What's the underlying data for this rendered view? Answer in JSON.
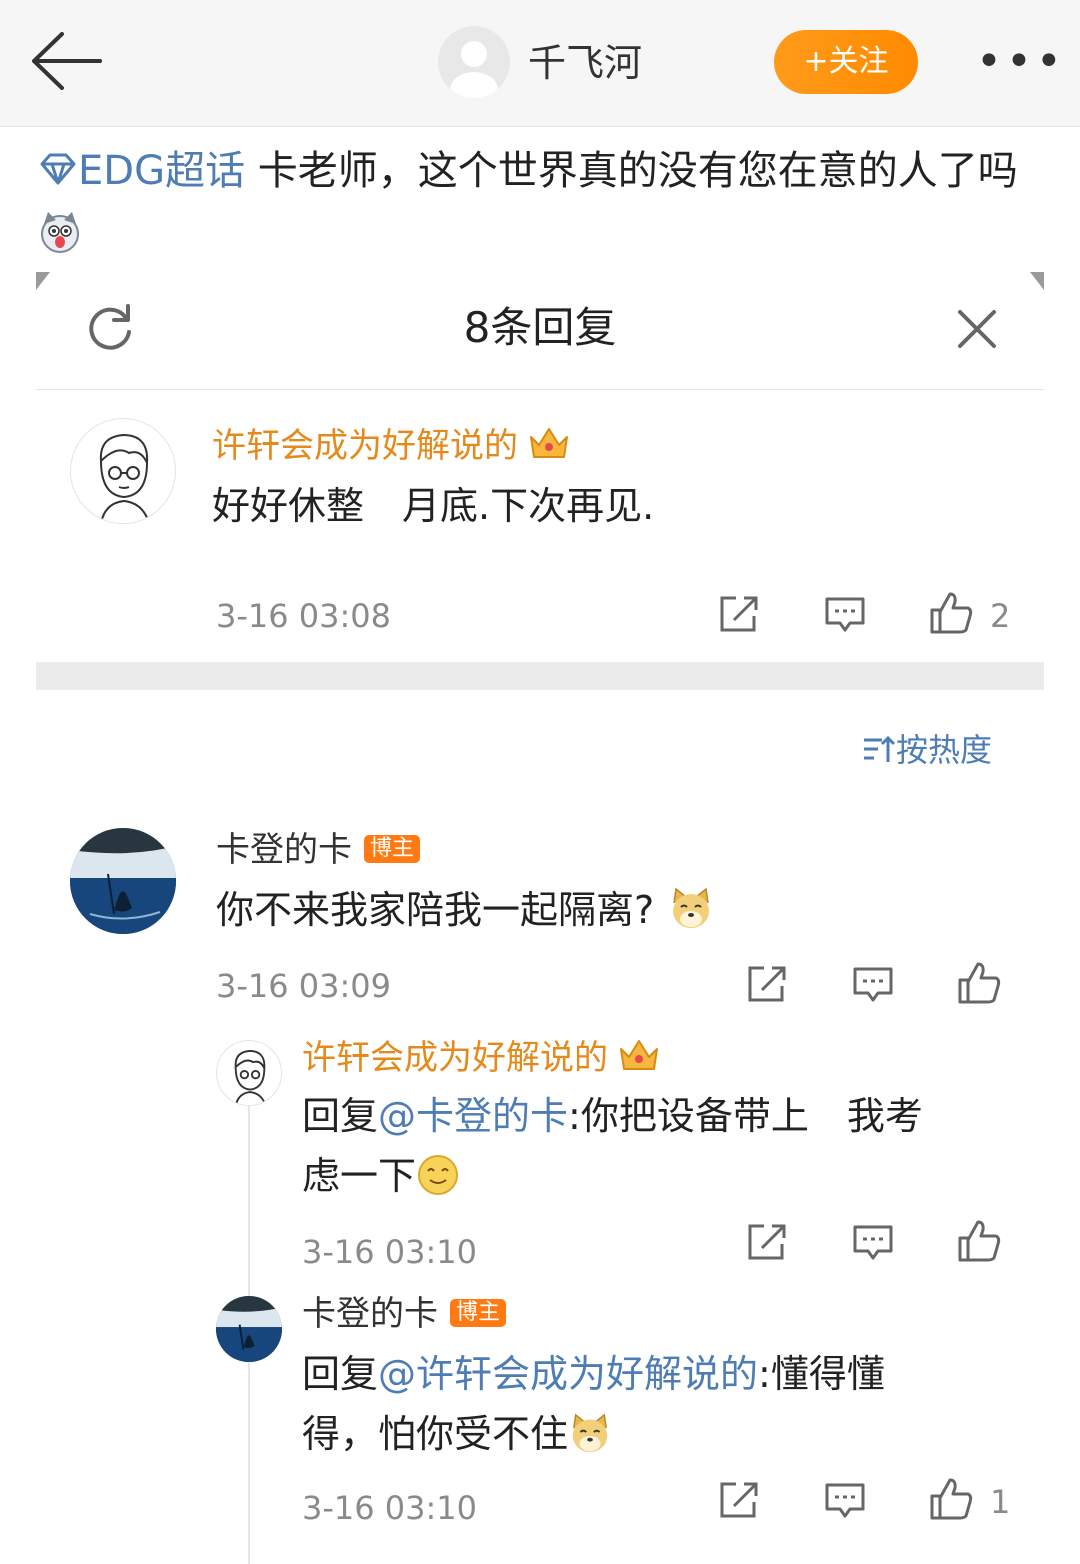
{
  "nav": {
    "name": "千飞河",
    "follow_label": "+关注",
    "more_label": "•••"
  },
  "post": {
    "topic": "EDG超话",
    "text": " 卡老师，这个世界真的没有您在意的人了吗"
  },
  "panel": {
    "title": "8条回复"
  },
  "root_comment": {
    "user": "许轩会成为好解说的",
    "text": "好好休整　月底.下次再见.",
    "time": "3-16 03:08",
    "likes": "2"
  },
  "sort_label": "按热度",
  "comments": [
    {
      "user": "卡登的卡",
      "badge": "博主",
      "text": "你不来我家陪我一起隔离?",
      "time": "3-16 03:09",
      "likes": ""
    },
    {
      "user": "许轩会成为好解说的",
      "reply_prefix": "回复",
      "mention": "@卡登的卡",
      "text_line1": ":你把设备带上　我考",
      "text_line2": "虑一下",
      "time": "3-16 03:10",
      "likes": ""
    },
    {
      "user": "卡登的卡",
      "badge": "博主",
      "reply_prefix": "回复",
      "mention": "@许轩会成为好解说的",
      "text_line1": ":懂得懂",
      "text_line2": "得，怕你受不住",
      "time": "3-16 03:10",
      "likes": "1"
    }
  ],
  "colors": {
    "accent_orange": "#ff8a00",
    "link_blue": "#4e7db3",
    "username_gold": "#e48a1c",
    "badge_orange": "#ff7a12"
  }
}
